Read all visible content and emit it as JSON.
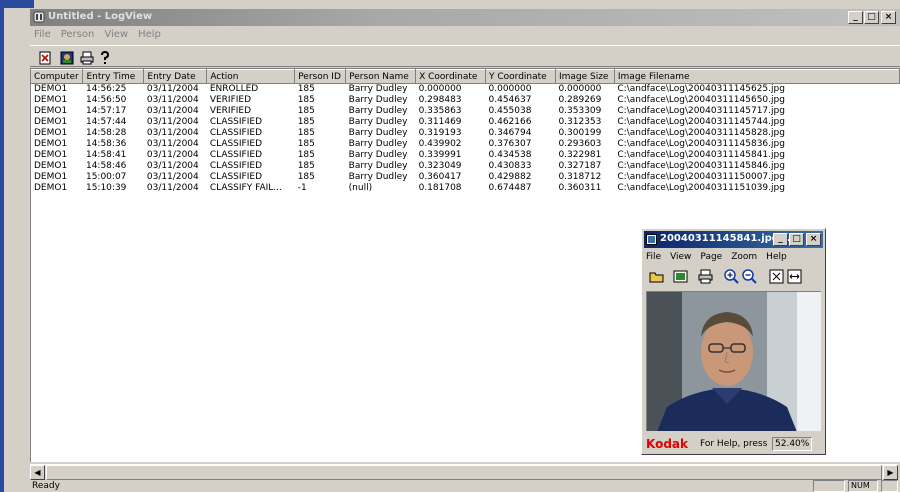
{
  "window": {
    "title": "Untitled - LogView",
    "minimize": "_",
    "maximize": "□",
    "close": "×"
  },
  "menu": [
    "File",
    "Person",
    "View",
    "Help"
  ],
  "toolbar_icons": [
    "new-document-icon",
    "photo-icon",
    "print-icon",
    "help-icon"
  ],
  "table": {
    "columns": [
      "Computer",
      "Entry Time",
      "Entry Date",
      "Action",
      "Person ID",
      "Person Name",
      "X Coordinate",
      "Y Coordinate",
      "Image Size",
      "Image Filename"
    ],
    "rows": [
      [
        "DEMO1",
        "14:56:25",
        "03/11/2004",
        "ENROLLED",
        "185",
        "Barry Dudley",
        "0.000000",
        "0.000000",
        "0.000000",
        "C:\\andface\\Log\\20040311145625.jpg"
      ],
      [
        "DEMO1",
        "14:56:50",
        "03/11/2004",
        "VERIFIED",
        "185",
        "Barry Dudley",
        "0.298483",
        "0.454637",
        "0.289269",
        "C:\\andface\\Log\\20040311145650.jpg"
      ],
      [
        "DEMO1",
        "14:57:17",
        "03/11/2004",
        "VERIFIED",
        "185",
        "Barry Dudley",
        "0.335863",
        "0.455038",
        "0.353309",
        "C:\\andface\\Log\\20040311145717.jpg"
      ],
      [
        "DEMO1",
        "14:57:44",
        "03/11/2004",
        "CLASSIFIED",
        "185",
        "Barry Dudley",
        "0.311469",
        "0.462166",
        "0.312353",
        "C:\\andface\\Log\\20040311145744.jpg"
      ],
      [
        "DEMO1",
        "14:58:28",
        "03/11/2004",
        "CLASSIFIED",
        "185",
        "Barry Dudley",
        "0.319193",
        "0.346794",
        "0.300199",
        "C:\\andface\\Log\\20040311145828.jpg"
      ],
      [
        "DEMO1",
        "14:58:36",
        "03/11/2004",
        "CLASSIFIED",
        "185",
        "Barry Dudley",
        "0.439902",
        "0.376307",
        "0.293603",
        "C:\\andface\\Log\\20040311145836.jpg"
      ],
      [
        "DEMO1",
        "14:58:41",
        "03/11/2004",
        "CLASSIFIED",
        "185",
        "Barry Dudley",
        "0.339991",
        "0.434538",
        "0.322981",
        "C:\\andface\\Log\\20040311145841.jpg"
      ],
      [
        "DEMO1",
        "14:58:46",
        "03/11/2004",
        "CLASSIFIED",
        "185",
        "Barry Dudley",
        "0.323049",
        "0.430833",
        "0.327187",
        "C:\\andface\\Log\\20040311145846.jpg"
      ],
      [
        "DEMO1",
        "15:00:07",
        "03/11/2004",
        "CLASSIFIED",
        "185",
        "Barry Dudley",
        "0.360417",
        "0.429882",
        "0.318712",
        "C:\\andface\\Log\\20040311150007.jpg"
      ],
      [
        "DEMO1",
        "15:10:39",
        "03/11/2004",
        "CLASSIFY FAIL...",
        "-1",
        "(null)",
        "0.181708",
        "0.674487",
        "0.360311",
        "C:\\andface\\Log\\20040311151039.jpg"
      ]
    ]
  },
  "status": {
    "text": "Ready",
    "num": "NUM"
  },
  "viewer": {
    "title": "20040311145841.jpg...",
    "menu": [
      "File",
      "View",
      "Page",
      "Zoom",
      "Help"
    ],
    "tool_icons": [
      "open-folder-icon",
      "image-icon",
      "print-icon",
      "zoom-in-icon",
      "zoom-out-icon",
      "fit-page-icon",
      "fit-width-icon"
    ],
    "brand": "Kodak",
    "help": "For Help, press",
    "zoom": "52.40%"
  },
  "colors": {
    "title_inactive": "#a8a8a8",
    "viewer_title": "#0a246a",
    "kodak_red": "#e00000",
    "chrome": "#d4d0c8"
  }
}
